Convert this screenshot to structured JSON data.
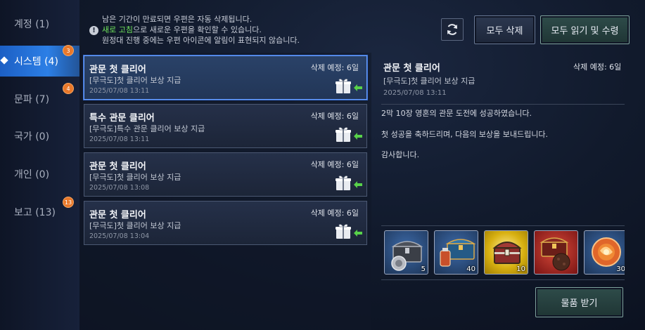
{
  "sidebar": {
    "items": [
      {
        "label": "계정 (1)",
        "badge": ""
      },
      {
        "label": "시스템 (4)",
        "badge": "3"
      },
      {
        "label": "문파 (7)",
        "badge": "4"
      },
      {
        "label": "국가 (0)",
        "badge": ""
      },
      {
        "label": "개인 (0)",
        "badge": ""
      },
      {
        "label": "보고 (13)",
        "badge": "13"
      }
    ],
    "active_index": 1
  },
  "notice": {
    "line1": "남은 기간이 만료되면 우편은 자동 삭제됩니다.",
    "line2_highlight": "새로 고침",
    "line2_rest": "으로 새로운 우편을 확인할 수 있습니다.",
    "line3": "원정대 진행 중에는 우편 아이콘에 알림이 표현되지 않습니다.",
    "icon": "!"
  },
  "toolbar": {
    "refresh_icon": "refresh-icon",
    "delete_all_label": "모두 삭제",
    "read_all_label": "모두 읽기 및 수령"
  },
  "mails": [
    {
      "title": "관문 첫 클리어",
      "expire": "삭제 예정: 6일",
      "subject": "[무극도]첫 클리어 보상 지급",
      "date": "2025/07/08 13:11"
    },
    {
      "title": "특수 관문 클리어",
      "expire": "삭제 예정: 6일",
      "subject": "[무극도]특수 관문 클리어 보상 지급",
      "date": "2025/07/08 13:11"
    },
    {
      "title": "관문 첫 클리어",
      "expire": "삭제 예정: 6일",
      "subject": "[무극도]첫 클리어 보상 지급",
      "date": "2025/07/08 13:08"
    },
    {
      "title": "관문 첫 클리어",
      "expire": "삭제 예정: 6일",
      "subject": "[무극도]첫 클리어 보상 지급",
      "date": "2025/07/08 13:04"
    }
  ],
  "detail": {
    "title": "관문 첫 클리어",
    "expire": "삭제 예정: 6일",
    "subject": "[무극도]첫 클리어 보상 지급",
    "date": "2025/07/08 13:11",
    "body": [
      "2막 10장 영혼의 관문 도전에 성공하였습니다.",
      "첫 성공을 축하드리며, 다음의 보상을 보내드립니다.",
      "감사합니다."
    ],
    "rewards": [
      {
        "name": "silver-chest",
        "qty": "5",
        "bg": "#2a4a7a"
      },
      {
        "name": "blue-chest-and-potion",
        "qty": "40",
        "bg": "#2a4a7a"
      },
      {
        "name": "gold-chest",
        "qty": "10",
        "bg": "#c9a312"
      },
      {
        "name": "red-chest-and-rock",
        "qty": "",
        "bg": "#8a1e1e"
      },
      {
        "name": "orange-orb",
        "qty": "30",
        "bg": "#2a4a7a"
      }
    ],
    "claim_label": "물품 받기"
  },
  "colors": {
    "accent": "#2c7fe6",
    "badge": "#e9782a",
    "highlight": "#6fe25b"
  }
}
